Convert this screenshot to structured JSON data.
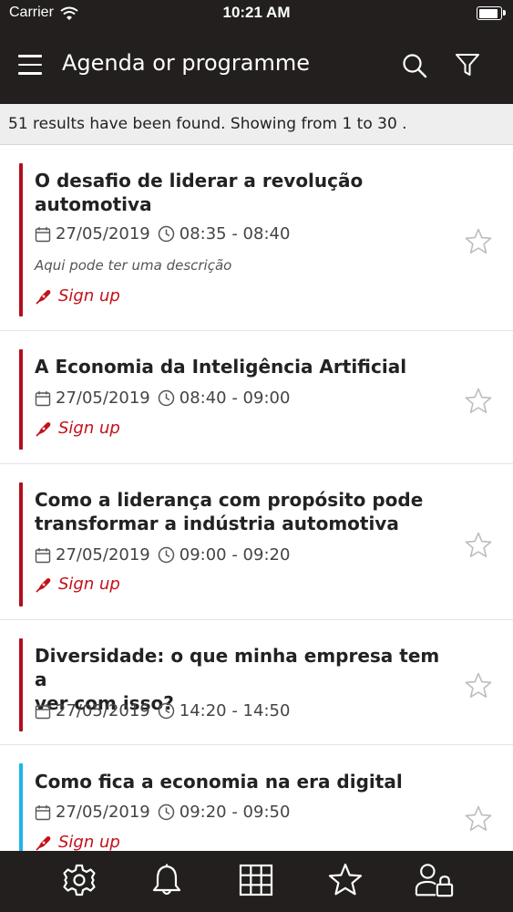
{
  "status": {
    "carrier": "Carrier",
    "time": "10:21 AM"
  },
  "header": {
    "title": "Agenda or programme"
  },
  "results_text": "51 results have been found. Showing from 1 to 30 .",
  "colors": {
    "accent_red": "#b0101c",
    "accent_cyan": "#1fb5e8",
    "dark": "#231f1f"
  },
  "sessions": [
    {
      "title_line1": "O desafio de liderar a revolução",
      "title_line2": "automotiva",
      "date": "27/05/2019",
      "time": "08:35 - 08:40",
      "description": "Aqui pode ter uma descrição",
      "signup": "Sign up",
      "bar_color": "#b0101c"
    },
    {
      "title_line1": "A Economia da Inteligência Artificial",
      "title_line2": "",
      "date": "27/05/2019",
      "time": "08:40 - 09:00",
      "signup": "Sign up",
      "bar_color": "#b0101c"
    },
    {
      "title_line1": "Como a liderança com propósito pode",
      "title_line2": "transformar a indústria automotiva",
      "date": "27/05/2019",
      "time": "09:00 - 09:20",
      "signup": "Sign up",
      "bar_color": "#b0101c"
    },
    {
      "title_line1": "Diversidade: o que minha empresa tem a",
      "title_line2": "ver com isso?",
      "date": "27/05/2019",
      "time": "14:20 - 14:50",
      "bar_color": "#b0101c"
    },
    {
      "title_line1": "Como fica a economia na era digital",
      "title_line2": "",
      "date": "27/05/2019",
      "time": "09:20 - 09:50",
      "signup": "Sign up",
      "bar_color": "#1fb5e8"
    }
  ],
  "tabbar": [
    "gear-icon",
    "bell-icon",
    "grid-icon",
    "star-icon",
    "user-lock-icon"
  ]
}
